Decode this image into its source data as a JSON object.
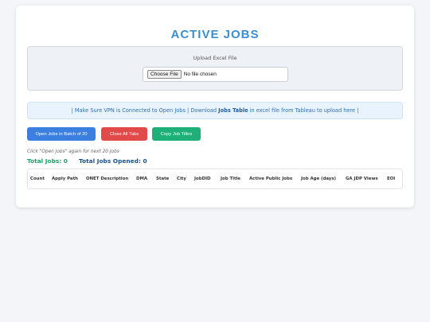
{
  "page": {
    "title": "ACTIVE JOBS"
  },
  "upload": {
    "label": "Upload Excel File",
    "choose_button": "Choose File",
    "status": "No file chosen"
  },
  "info": {
    "prefix": "| Make Sure VPN is Connected to Open Jobs | Download",
    "link": "Jobs Table",
    "suffix": "in excel file from Tableau to upload here |"
  },
  "buttons": {
    "open": "Open Jobs in Batch of 20",
    "close": "Close All Tabs",
    "copy": "Copy Job Titles"
  },
  "hint": "Click \"Open Jobs\" again for next 20 Jobs",
  "totals": {
    "jobs": "Total Jobs: 0",
    "opened": "Total Jobs Opened: 0"
  },
  "table": {
    "columns": [
      "Count",
      "Apply Path",
      "ONET Description",
      "DMA",
      "State",
      "City",
      "JobDID",
      "Job Title",
      "Active Public Jobs",
      "Job Age (days)",
      "GA JDP Views",
      "EOI"
    ]
  },
  "colors": {
    "accent": "#3a8fd0",
    "open_button": "#3b7fe0",
    "close_button": "#e24a4a",
    "copy_button": "#1fb07a",
    "total_jobs": "#1f9e6a",
    "total_opened": "#1b4f8c"
  }
}
